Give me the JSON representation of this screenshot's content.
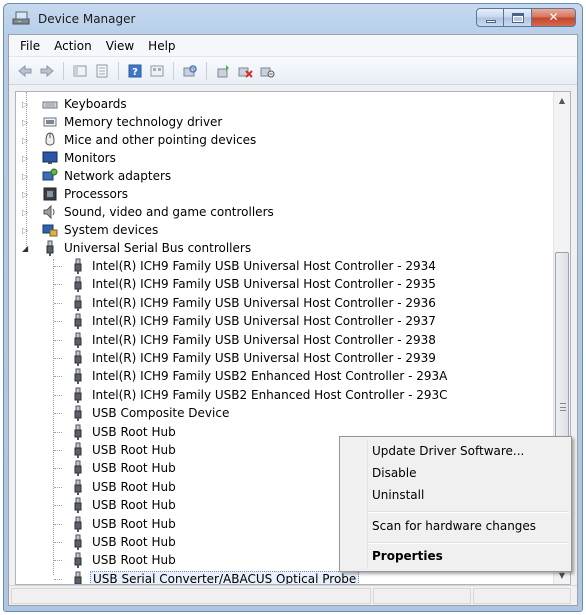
{
  "window": {
    "title": "Device Manager"
  },
  "menu": [
    "File",
    "Action",
    "View",
    "Help"
  ],
  "toolbar_icons": [
    "back-icon",
    "forward-icon",
    "show-hide-tree-icon",
    "properties-icon",
    "help-icon",
    "view-icon",
    "scan-hardware-icon",
    "update-driver-icon",
    "uninstall-icon",
    "disable-icon"
  ],
  "tree": {
    "categories": [
      {
        "label": "Keyboards",
        "icon": "keyboard-icon"
      },
      {
        "label": "Memory technology driver",
        "icon": "memory-icon"
      },
      {
        "label": "Mice and other pointing devices",
        "icon": "mouse-icon"
      },
      {
        "label": "Monitors",
        "icon": "monitor-icon"
      },
      {
        "label": "Network adapters",
        "icon": "network-adapter-icon"
      },
      {
        "label": "Processors",
        "icon": "processor-icon"
      },
      {
        "label": "Sound, video and game controllers",
        "icon": "sound-icon"
      },
      {
        "label": "System devices",
        "icon": "system-devices-icon"
      },
      {
        "label": "Universal Serial Bus controllers",
        "icon": "usb-icon"
      }
    ],
    "usb_children": [
      "Intel(R) ICH9 Family USB Universal Host Controller - 2934",
      "Intel(R) ICH9 Family USB Universal Host Controller - 2935",
      "Intel(R) ICH9 Family USB Universal Host Controller - 2936",
      "Intel(R) ICH9 Family USB Universal Host Controller - 2937",
      "Intel(R) ICH9 Family USB Universal Host Controller - 2938",
      "Intel(R) ICH9 Family USB Universal Host Controller - 2939",
      "Intel(R) ICH9 Family USB2 Enhanced Host Controller - 293A",
      "Intel(R) ICH9 Family USB2 Enhanced Host Controller - 293C",
      "USB Composite Device",
      "USB Root Hub",
      "USB Root Hub",
      "USB Root Hub",
      "USB Root Hub",
      "USB Root Hub",
      "USB Root Hub",
      "USB Root Hub",
      "USB Root Hub",
      "USB Serial Converter/ABACUS Optical Probe"
    ],
    "selected": "USB Serial Converter/ABACUS Optical Probe"
  },
  "context_menu": {
    "items": [
      {
        "label": "Update Driver Software...",
        "bold": false
      },
      {
        "label": "Disable",
        "bold": false
      },
      {
        "label": "Uninstall",
        "bold": false
      },
      {
        "label": "Scan for hardware changes",
        "bold": false
      },
      {
        "label": "Properties",
        "bold": true
      }
    ]
  },
  "colors": {
    "titlebar": "#b9d1ea",
    "close_button": "#c7432a",
    "selection": "#e8f0fb"
  }
}
